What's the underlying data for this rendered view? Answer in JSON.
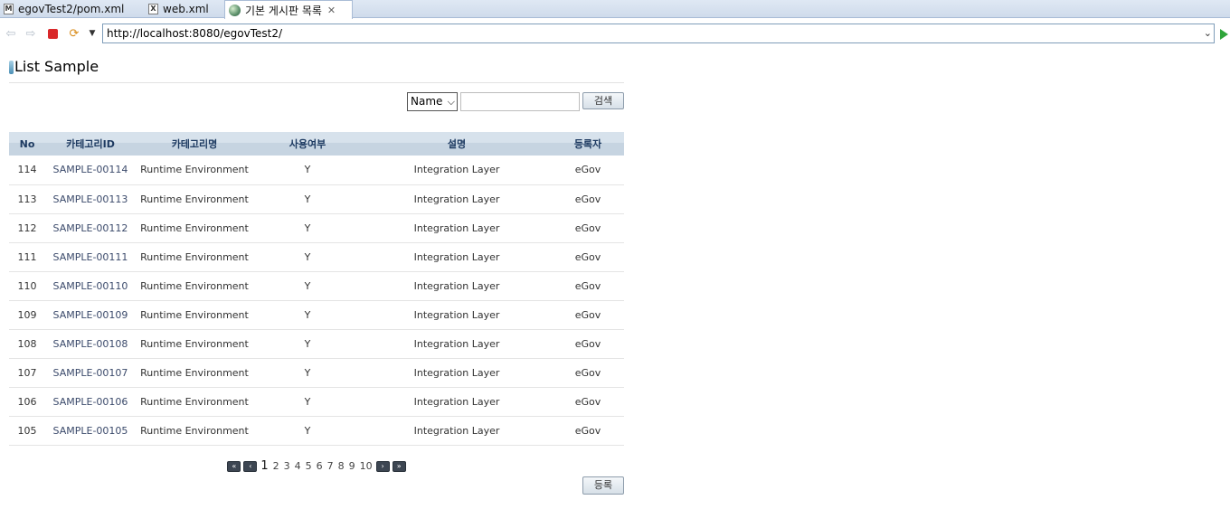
{
  "tabs": [
    {
      "label": "egovTest2/pom.xml",
      "icon": "M"
    },
    {
      "label": "web.xml",
      "icon": "X"
    },
    {
      "label": "기본 게시판 목록",
      "icon": "globe-icon",
      "active": true
    }
  ],
  "browser": {
    "url": "http://localhost:8080/egovTest2/"
  },
  "page": {
    "title": "List Sample"
  },
  "search": {
    "select_value": "Name",
    "input_value": "",
    "button_label": "검색"
  },
  "table": {
    "headers": [
      "No",
      "카테고리ID",
      "카테고리명",
      "사용여부",
      "설명",
      "등록자"
    ],
    "rows": [
      [
        "114",
        "SAMPLE-00114",
        "Runtime Environment",
        "Y",
        "Integration Layer",
        "eGov"
      ],
      [
        "113",
        "SAMPLE-00113",
        "Runtime Environment",
        "Y",
        "Integration Layer",
        "eGov"
      ],
      [
        "112",
        "SAMPLE-00112",
        "Runtime Environment",
        "Y",
        "Integration Layer",
        "eGov"
      ],
      [
        "111",
        "SAMPLE-00111",
        "Runtime Environment",
        "Y",
        "Integration Layer",
        "eGov"
      ],
      [
        "110",
        "SAMPLE-00110",
        "Runtime Environment",
        "Y",
        "Integration Layer",
        "eGov"
      ],
      [
        "109",
        "SAMPLE-00109",
        "Runtime Environment",
        "Y",
        "Integration Layer",
        "eGov"
      ],
      [
        "108",
        "SAMPLE-00108",
        "Runtime Environment",
        "Y",
        "Integration Layer",
        "eGov"
      ],
      [
        "107",
        "SAMPLE-00107",
        "Runtime Environment",
        "Y",
        "Integration Layer",
        "eGov"
      ],
      [
        "106",
        "SAMPLE-00106",
        "Runtime Environment",
        "Y",
        "Integration Layer",
        "eGov"
      ],
      [
        "105",
        "SAMPLE-00105",
        "Runtime Environment",
        "Y",
        "Integration Layer",
        "eGov"
      ]
    ]
  },
  "pagination": {
    "pages": [
      "1",
      "2",
      "3",
      "4",
      "5",
      "6",
      "7",
      "8",
      "9",
      "10"
    ],
    "current": "1"
  },
  "register_label": "등록"
}
